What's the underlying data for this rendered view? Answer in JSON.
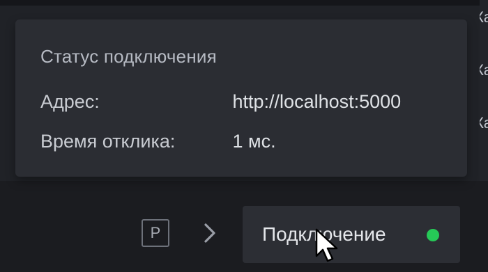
{
  "background": {
    "right_edge_letters": [
      "Ка",
      "Ка",
      "Ка"
    ]
  },
  "popover": {
    "title": "Статус подключения",
    "rows": [
      {
        "label": "Адрес:",
        "value": "http://localhost:5000"
      },
      {
        "label": "Время отклика:",
        "value": "1 мс."
      }
    ]
  },
  "bottom_bar": {
    "badge_text": "P",
    "chevron_icon": "chevron-right-icon",
    "connection_button_label": "Подключение",
    "status_color": "#26c957"
  },
  "colors": {
    "background": "#1b1c20",
    "popover_bg": "#2b2d33",
    "status_ok": "#26c957"
  }
}
